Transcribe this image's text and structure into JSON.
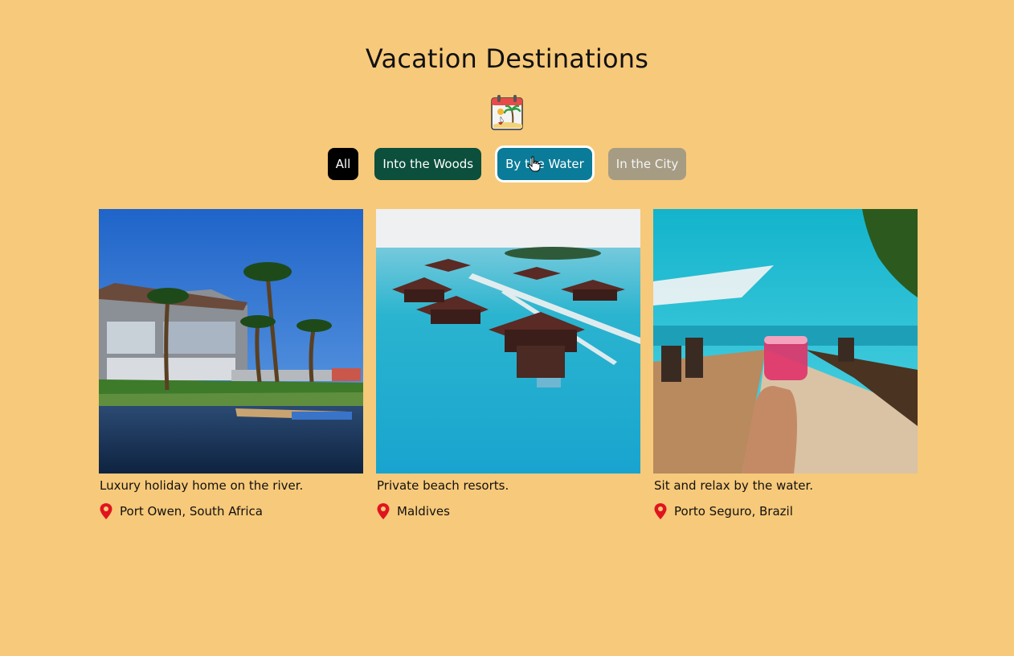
{
  "page": {
    "title": "Vacation Destinations",
    "header_icon": "vacation-calendar-icon"
  },
  "filters": [
    {
      "label": "All",
      "color": "#000000"
    },
    {
      "label": "Into the Woods",
      "color": "#0b4f3c"
    },
    {
      "label": "By the Water",
      "color": "#0a7b98",
      "active": true
    },
    {
      "label": "In the City",
      "color": "#a69c84"
    }
  ],
  "cards": [
    {
      "image": "river-holiday-home-photo",
      "caption": "Luxury holiday home on the river.",
      "location": "Port Owen, South Africa"
    },
    {
      "image": "overwater-bungalows-photo",
      "caption": "Private beach resorts.",
      "location": "Maldives"
    },
    {
      "image": "beach-drink-photo",
      "caption": "Sit and relax by the water.",
      "location": "Porto Seguro, Brazil"
    }
  ],
  "colors": {
    "background": "#f7c97a",
    "pin": "#e0141f"
  }
}
